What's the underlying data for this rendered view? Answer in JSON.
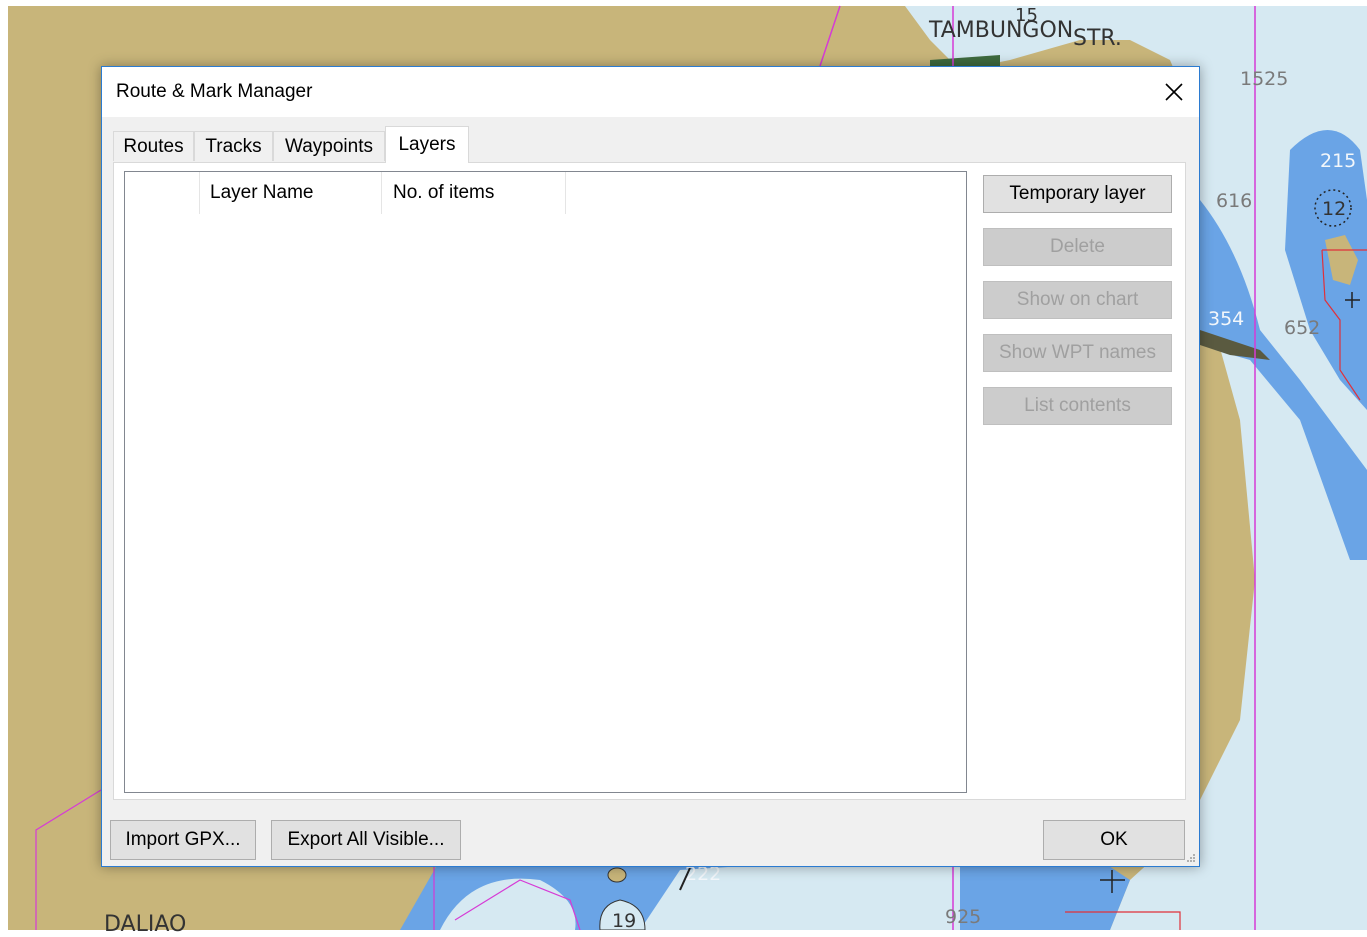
{
  "chart": {
    "labels": [
      {
        "text": "TAMBUNGON",
        "class": "dark"
      },
      {
        "text": "STR.",
        "class": "dark"
      },
      {
        "text": "15",
        "class": "dark"
      },
      {
        "text": "1525",
        "class": ""
      },
      {
        "text": "215",
        "class": "white"
      },
      {
        "text": "616",
        "class": ""
      },
      {
        "text": "12",
        "class": "dark"
      },
      {
        "text": "354",
        "class": "white"
      },
      {
        "text": "652",
        "class": ""
      },
      {
        "text": "222",
        "class": "white"
      },
      {
        "text": "19",
        "class": "dark"
      },
      {
        "text": "925",
        "class": ""
      },
      {
        "text": "DALIAO",
        "class": "dark"
      }
    ],
    "colors": {
      "land": "#c8b57a",
      "deep_water": "#d6e9f2",
      "shallow_water": "#6aa4e6",
      "boundary": "#d63bd6"
    }
  },
  "dialog": {
    "title": "Route & Mark Manager",
    "close_icon": "close-icon"
  },
  "tabs": {
    "routes": "Routes",
    "tracks": "Tracks",
    "waypoints": "Waypoints",
    "layers": "Layers",
    "active": "layers"
  },
  "layers_list": {
    "columns": {
      "layer_name": "Layer Name",
      "num_items": "No. of items"
    },
    "rows": []
  },
  "side_buttons": {
    "temporary_layer": "Temporary layer",
    "delete": "Delete",
    "show_on_chart": "Show on chart",
    "show_wpt_names": "Show WPT names",
    "list_contents": "List contents"
  },
  "bottom": {
    "import_gpx": "Import GPX...",
    "export_all_visible": "Export All Visible...",
    "ok": "OK"
  }
}
